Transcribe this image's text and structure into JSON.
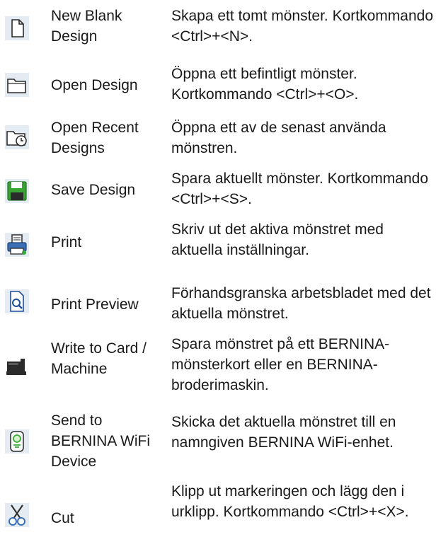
{
  "rows": [
    {
      "icon": "new-blank-design-icon",
      "name": "New Blank Design",
      "desc": "Skapa ett tomt mönster. Kortkommando <Ctrl>+<N>."
    },
    {
      "icon": "open-design-icon",
      "name": "Open Design",
      "desc": "Öppna ett befintligt mönster. Kortkommando <Ctrl>+<O>."
    },
    {
      "icon": "open-recent-designs-icon",
      "name": "Open Recent Designs",
      "desc": "Öppna ett av de senast använda mönstren."
    },
    {
      "icon": "save-design-icon",
      "name": "Save Design",
      "desc": "Spara aktuellt mönster. Kortkommando <Ctrl>+<S>."
    },
    {
      "icon": "print-icon",
      "name": "Print",
      "desc": "Skriv ut det aktiva mönstret med aktuella inställningar."
    },
    {
      "icon": "print-preview-icon",
      "name": "Print Preview",
      "desc": "Förhandsgranska arbetsbladet med det aktuella mönstret."
    },
    {
      "icon": "write-to-card-machine-icon",
      "name": "Write to Card / Machine",
      "desc": "Spara mönstret på ett BERNINA-mönsterkort eller en BERNINA-broderimaskin."
    },
    {
      "icon": "send-to-wifi-device-icon",
      "name": "Send to BERNINA WiFi Device",
      "desc": "Skicka det aktuella mönstret till en namngiven BERNINA WiFi-enhet."
    },
    {
      "icon": "cut-icon",
      "name": "Cut",
      "desc": "Klipp ut markeringen och lägg den i urklipp. Kortkommando <Ctrl>+<X>."
    }
  ]
}
